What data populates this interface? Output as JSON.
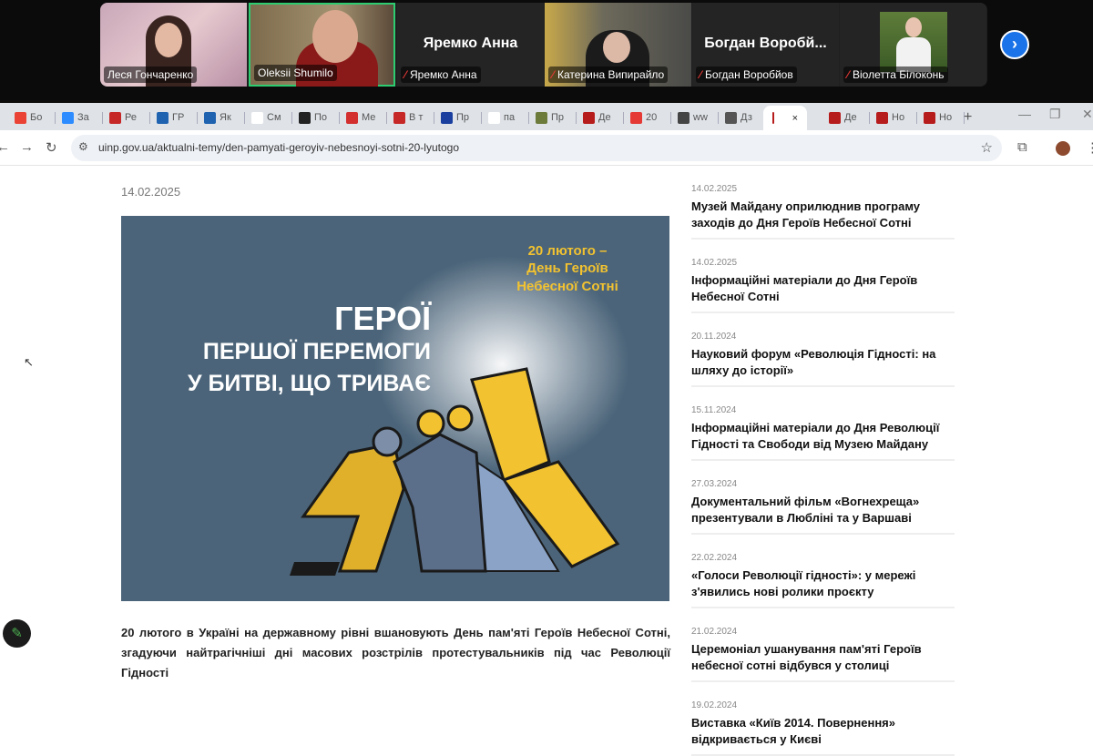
{
  "meeting": {
    "participants": [
      {
        "label": "Леся Гончаренко",
        "video": true,
        "muted": false
      },
      {
        "label": "Oleksii Shumilo",
        "video": true,
        "muted": false,
        "active_speaker": true
      },
      {
        "display": "Яремко Анна",
        "label": "Яремко Анна",
        "video": false,
        "muted": true
      },
      {
        "label": "Катерина Випирайло",
        "video": true,
        "muted": true
      },
      {
        "display": "Богдан Воробй...",
        "label": "Богдан Воробйов",
        "video": false,
        "muted": true
      },
      {
        "label": "Віолетта Білоконь",
        "video": true,
        "muted": true
      }
    ],
    "next_icon": "›"
  },
  "browser": {
    "tabs": [
      "Бо",
      "За",
      "Ре",
      "ГР",
      "Як",
      "См",
      "По",
      "Ме",
      "В т",
      "Пр",
      "па",
      "Пр",
      "Де",
      "20",
      "ww",
      "Дз",
      "",
      "Де",
      "Но",
      "Но"
    ],
    "active_tab_index": 16,
    "close_icon": "×",
    "new_tab": "+",
    "url": "uinp.gov.ua/aktualni-temy/den-pamyati-geroyiv-nebesnoyi-sotni-20-lyutogo"
  },
  "article": {
    "date": "14.02.2025",
    "poster": {
      "subtitle_line1": "20 лютого –",
      "subtitle_line2": "День Героїв",
      "subtitle_line3": "Небесної Сотні",
      "title_line1": "ГЕРОЇ",
      "title_line2": "ПЕРШОЇ ПЕРЕМОГИ",
      "title_line3": "У БИТВІ, ЩО ТРИВАЄ"
    },
    "body": "20 лютого в Україні на державному рівні вшановують День пам'яті Героїв Небесної Сотні, згадуючи найтрагічніші дні масових розстрілів протестувальників під час Революції Гідності"
  },
  "sidebar": {
    "items": [
      {
        "date": "14.02.2025",
        "title": "Музей Майдану оприлюднив програму заходів до Дня Героїв Небесної Сотні"
      },
      {
        "date": "14.02.2025",
        "title": "Інформаційні матеріали до Дня Героїв Небесної Сотні"
      },
      {
        "date": "20.11.2024",
        "title": "Науковий форум «Революція Гідності: на шляху до історії»"
      },
      {
        "date": "15.11.2024",
        "title": "Інформаційні матеріали до Дня Революції Гідності та Свободи від Музею Майдану"
      },
      {
        "date": "27.03.2024",
        "title": "Документальний фільм «Вогнехреща» презентували в Любліні та у Варшаві"
      },
      {
        "date": "22.02.2024",
        "title": "«Голоси Революції гідності»: у мережі з'явились нові ролики проєкту"
      },
      {
        "date": "21.02.2024",
        "title": "Церемоніал ушанування пам'яті Героїв небесної сотні відбувся у столиці"
      },
      {
        "date": "19.02.2024",
        "title": "Виставка «Київ 2014. Повернення» відкривається у Києві"
      }
    ]
  },
  "colors": {
    "poster_bg": "#4b6479",
    "poster_yellow": "#f2c230",
    "speaker_border": "#2ecc71",
    "accent": "#1a73e8"
  }
}
